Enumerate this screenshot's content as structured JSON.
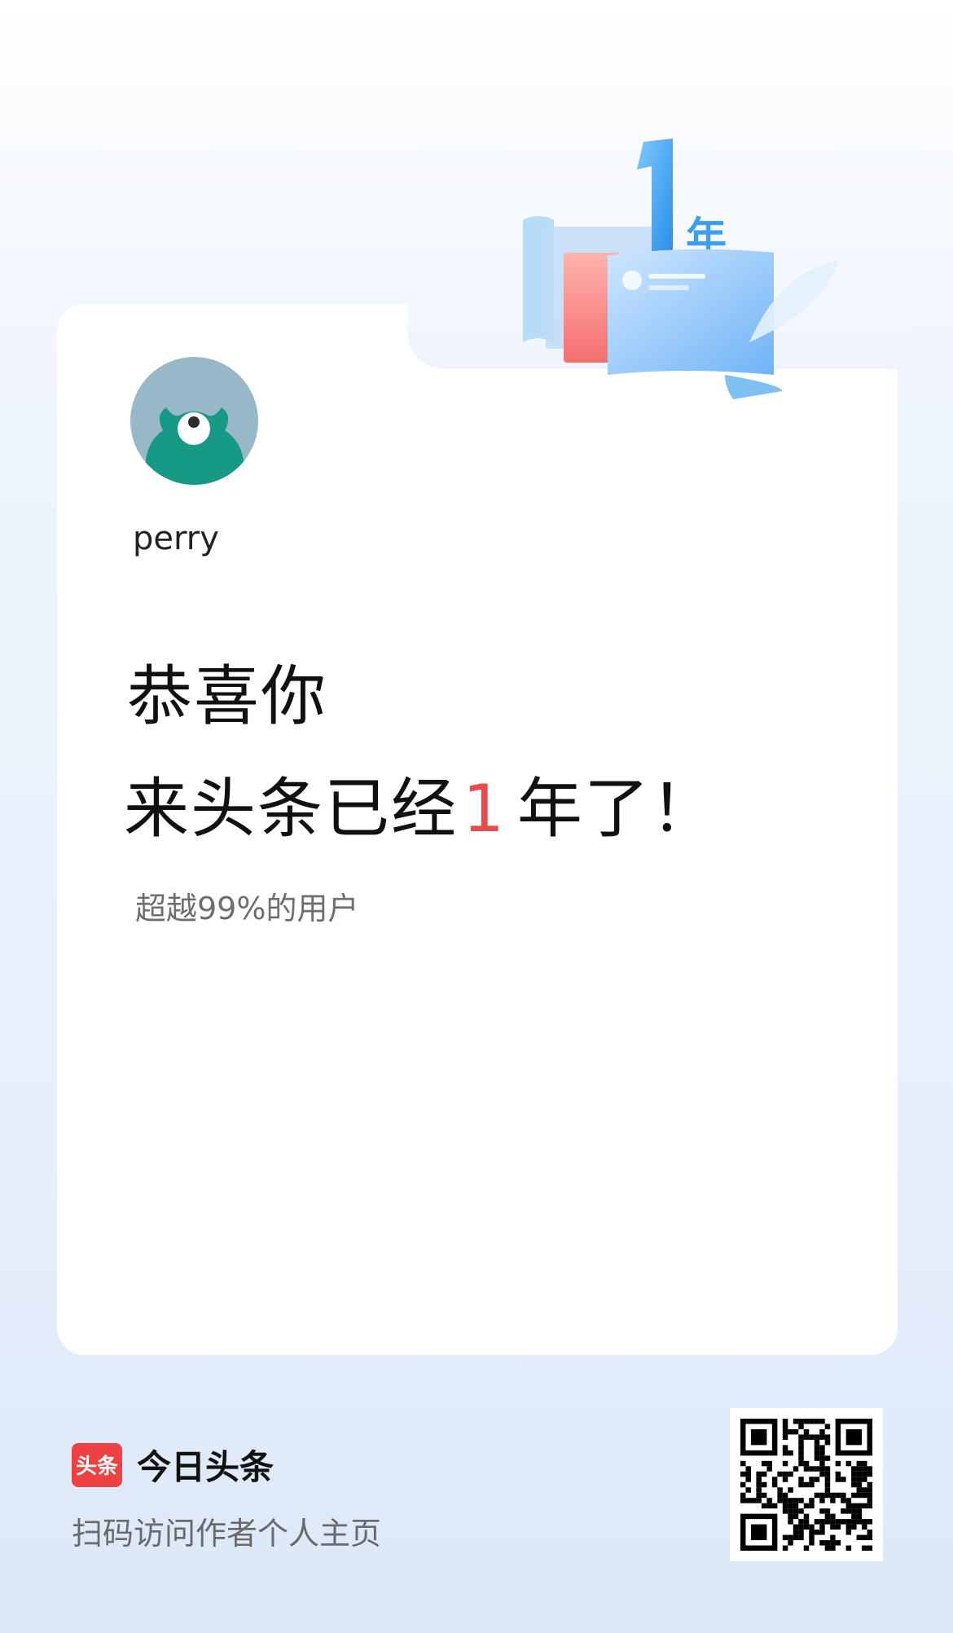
{
  "badge": {
    "number": "1",
    "unit": "年"
  },
  "profile": {
    "username": "perry"
  },
  "headline": {
    "line1": "恭喜你",
    "line2_prefix": "来头条已经",
    "years": "1",
    "line2_suffix": "年了！"
  },
  "subtitle": "超越99%的用户",
  "footer": {
    "logo_text": "头条",
    "brand_name": "今日头条",
    "scan_tip": "扫码访问作者个人主页"
  },
  "colors": {
    "accent_red": "#e84b4b",
    "brand_red": "#f04142",
    "badge_blue": "#3d9ef0"
  }
}
